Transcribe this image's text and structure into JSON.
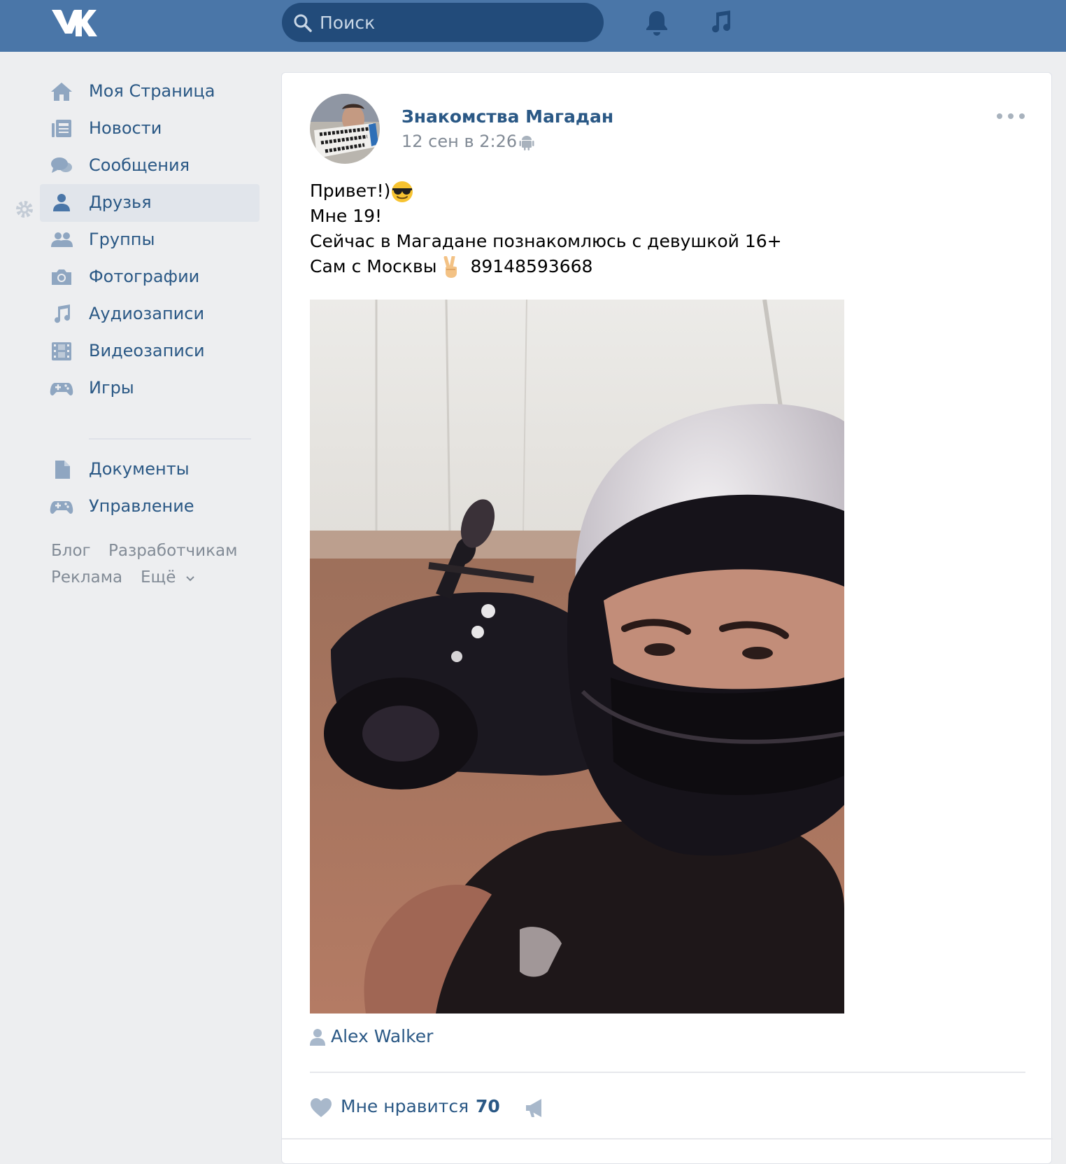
{
  "header": {
    "search_placeholder": "Поиск"
  },
  "sidebar": {
    "items": [
      {
        "label": "Моя Страница",
        "icon": "home-icon"
      },
      {
        "label": "Новости",
        "icon": "news-icon"
      },
      {
        "label": "Сообщения",
        "icon": "messages-icon"
      },
      {
        "label": "Друзья",
        "icon": "friends-icon",
        "active": true
      },
      {
        "label": "Группы",
        "icon": "groups-icon"
      },
      {
        "label": "Фотографии",
        "icon": "camera-icon"
      },
      {
        "label": "Аудиозаписи",
        "icon": "music-note-icon"
      },
      {
        "label": "Видеозаписи",
        "icon": "film-icon"
      },
      {
        "label": "Игры",
        "icon": "gamepad-icon"
      },
      {
        "label": "Документы",
        "icon": "document-icon"
      },
      {
        "label": "Управление",
        "icon": "gamepad-icon"
      }
    ],
    "footer": {
      "blog": "Блог",
      "developers": "Разработчикам",
      "ads": "Реклама",
      "more": "Ещё"
    }
  },
  "post": {
    "author": "Знакомства Магадан",
    "date": "12 сен в 2:26",
    "lines": [
      "Привет!)",
      "Мне 19!",
      "Сейчас в Магадане познакомлюсь с девушкой 16+",
      "Сам с Москвы",
      "89148593668"
    ],
    "signer": "Alex Walker",
    "like_label": "Мне нравится",
    "like_count": "70"
  },
  "colors": {
    "header": "#4a76a8",
    "search_bg": "#224b7a",
    "link": "#2a5885",
    "muted": "#828b96",
    "nav_icon": "#8fa6c1",
    "page_bg": "#edeef0"
  }
}
